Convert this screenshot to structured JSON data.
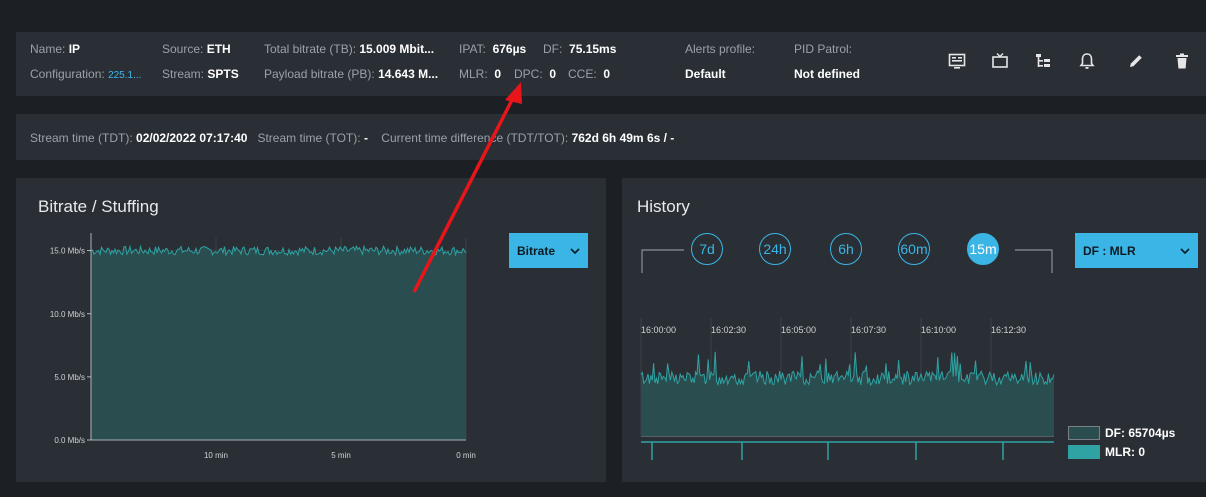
{
  "info": {
    "name_label": "Name:",
    "name_value": "IP",
    "config_label": "Configuration:",
    "config_value": "225.1...",
    "source_label": "Source:",
    "source_value": "ETH",
    "stream_label": "Stream:",
    "stream_value": "SPTS",
    "tb_label": "Total bitrate (TB):",
    "tb_value": "15.009 Mbit...",
    "pb_label": "Payload bitrate (PB):",
    "pb_value": "14.643 M...",
    "ipat_label": "IPAT:",
    "ipat_value": "676µs",
    "df_label": "DF:",
    "df_value": "75.15ms",
    "mlr_label": "MLR:",
    "mlr_value": "0",
    "dpc_label": "DPC:",
    "dpc_value": "0",
    "cce_label": "CCE:",
    "cce_value": "0",
    "alerts_label": "Alerts profile:",
    "alerts_value": "Default",
    "pid_label": "PID Patrol:",
    "pid_value": "Not defined"
  },
  "icons": [
    "monitor-icon",
    "tv-icon",
    "tree-icon",
    "bell-icon",
    "pencil-icon",
    "trash-icon"
  ],
  "time_bar": {
    "tdt_label": "Stream time (TDT):",
    "tdt_value": "02/02/2022 07:17:40",
    "tot_label": "Stream time (TOT):",
    "tot_value": "-",
    "diff_label": "Current time difference (TDT/TOT):",
    "diff_value": "762d 6h 49m 6s / -"
  },
  "bitrate_panel": {
    "title": "Bitrate / Stuffing",
    "dropdown": "Bitrate"
  },
  "history_panel": {
    "title": "History",
    "ranges": [
      "7d",
      "24h",
      "6h",
      "60m",
      "15m"
    ],
    "active_range": "15m",
    "dropdown": "DF : MLR",
    "time_labels": [
      "16:00:00",
      "16:02:30",
      "16:05:00",
      "16:07:30",
      "16:10:00",
      "16:12:30"
    ],
    "legend": [
      {
        "label": "DF: 65704µs",
        "color": "#2a4d4f"
      },
      {
        "label": "MLR: 0",
        "color": "#2fa3a3"
      }
    ]
  },
  "chart_data": {
    "type": "area",
    "title": "Bitrate / Stuffing",
    "y_ticks": [
      "15.0 Mb/s",
      "10.0 Mb/s",
      "5.0 Mb/s",
      "0.0 Mb/s"
    ],
    "x_ticks": [
      "10 min",
      "5 min",
      "0 min"
    ],
    "ylim": [
      0,
      16
    ],
    "series": [
      {
        "values": [
          15.0,
          15.0
        ]
      }
    ]
  },
  "colors": {
    "accent": "#3ab5e6",
    "area_fill": "#2a4d4f",
    "area_line": "#2fa3a3",
    "arrow": "#e8151b"
  }
}
